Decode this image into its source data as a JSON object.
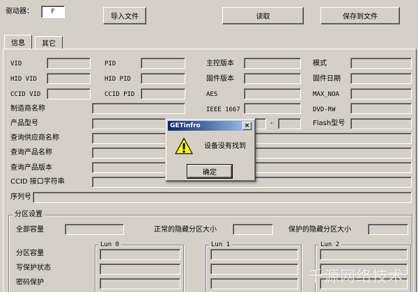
{
  "top": {
    "drive_label": "驱动器：",
    "drive_value": "F",
    "import_button": "导入文件",
    "read_button": "读取",
    "save_button": "保存到文件"
  },
  "tabs": [
    "信息",
    "其它"
  ],
  "info": {
    "vid": "VID",
    "pid": "PID",
    "master_version": "主控版本",
    "mode": "模式",
    "hid_vid": "HID VID",
    "hid_pid": "HID PID",
    "firmware_version": "固件版本",
    "firmware_date": "固件日期",
    "ccid_vid": "CCID VID",
    "ccid_pid": "CCID PID",
    "aes": "AES",
    "max_noa": "MAX_NOA",
    "manufacturer_name": "制造商名称",
    "ieee_1667": "IEEE 1667",
    "dvd_rw": "DVD-RW",
    "product_model": "产品型号",
    "dash": "-",
    "flash_model": "Flash型号",
    "query_vendor_name": "查询供应商名称",
    "query_product_name": "查询产品名称",
    "query_product_version": "查询产品版本",
    "ccid_interface_string": "CCID 接口字符串",
    "serial_number": "序列号"
  },
  "partition": {
    "group_title": "分区设置",
    "total_capacity": "全部容量",
    "normal_hidden_size": "正常的隐藏分区大小",
    "protected_hidden_size": "保护的隐藏分区大小",
    "partition_capacity": "分区容量",
    "write_protect_status": "写保护状态",
    "password_protect": "密码保护",
    "luns": [
      "Lun 0",
      "Lun 1",
      "Lun 2"
    ]
  },
  "dialog": {
    "title": "GETinfro",
    "close_glyph": "×",
    "message": "设备没有找到",
    "ok_button": "确定",
    "icon": "warning-icon"
  },
  "watermark": "千源网络技术"
}
